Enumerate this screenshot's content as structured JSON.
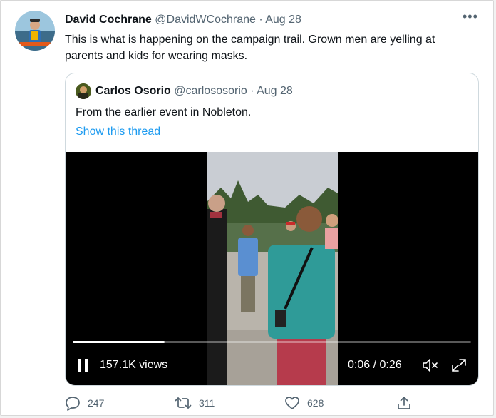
{
  "tweet": {
    "author_name": "David Cochrane",
    "handle": "@DavidWCochrane",
    "separator": "·",
    "date": "Aug 28",
    "more_icon": "more-horizontal-icon",
    "text": "This is what is happening on the campaign trail. Grown men are yelling at parents and kids for wearing masks."
  },
  "quoted": {
    "author_name": "Carlos Osorio",
    "handle": "@carlososorio",
    "separator": "·",
    "date": "Aug 28",
    "text": "From the earlier event in Nobleton.",
    "show_thread": "Show this thread"
  },
  "video": {
    "views": "157.1K views",
    "time": "0:06 / 0:26",
    "progress": 0.23,
    "pause_icon": "pause-icon",
    "mute_icon": "volume-muted-icon",
    "fullscreen_icon": "fullscreen-icon"
  },
  "actions": {
    "reply_count": "247",
    "retweet_count": "311",
    "like_count": "628"
  },
  "colors": {
    "link": "#1d9bf0",
    "muted": "#536471",
    "text": "#0f1419"
  }
}
